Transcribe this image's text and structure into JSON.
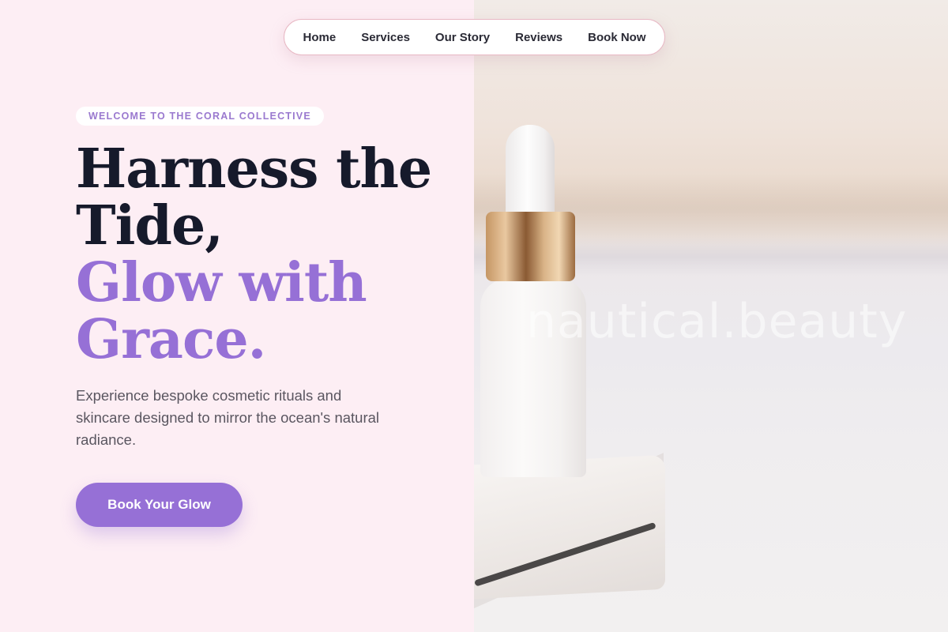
{
  "nav": {
    "items": [
      "Home",
      "Services",
      "Our Story",
      "Reviews",
      "Book Now"
    ]
  },
  "hero": {
    "eyebrow": "WELCOME TO THE CORAL COLLECTIVE",
    "headline_line1": "Harness the",
    "headline_line2": "Tide,",
    "headline_line3": "Glow with",
    "headline_line4": "Grace.",
    "description": "Experience bespoke cosmetic rituals and skincare designed to mirror the ocean's natural radiance.",
    "cta_label": "Book Your Glow"
  },
  "image": {
    "watermark": "nautical.beauty",
    "subject": "serum-dropper-bottle"
  },
  "colors": {
    "background": "#fdeef4",
    "accent": "#9670d6",
    "heading": "#161a2b",
    "nav_border": "#e8b8c4"
  }
}
